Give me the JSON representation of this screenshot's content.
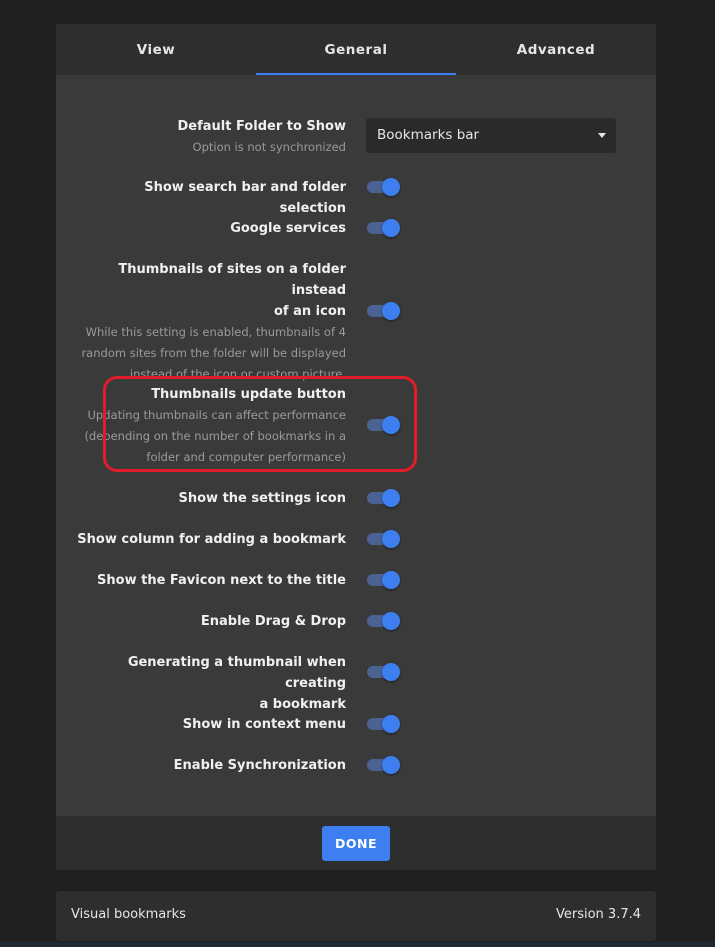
{
  "tabs": [
    {
      "label": "View"
    },
    {
      "label": "General"
    },
    {
      "label": "Advanced"
    }
  ],
  "active_tab": "General",
  "default_folder": {
    "label": "Default Folder to Show",
    "description": "Option is not synchronized",
    "selected_value": "Bookmarks bar"
  },
  "settings": [
    {
      "label": "Show search bar and folder selection",
      "enabled": true
    },
    {
      "label": "Google services",
      "enabled": true
    },
    {
      "label_line1": "Thumbnails of sites on a folder instead",
      "label_line2": "of an icon",
      "desc_line1": "While this setting is enabled, thumbnails of 4",
      "desc_line2": "random sites from the folder will be displayed",
      "desc_line3": "instead of the icon or custom picture.",
      "enabled": true
    },
    {
      "label": "Thumbnails update button",
      "desc_line1": "Updating thumbnails can affect performance",
      "desc_line2": "(depending on the number of bookmarks in a",
      "desc_line3": "folder and computer performance)",
      "enabled": true
    },
    {
      "label": "Show the settings icon",
      "enabled": true
    },
    {
      "label": "Show column for adding a bookmark",
      "enabled": true
    },
    {
      "label": "Show the Favicon next to the title",
      "enabled": true
    },
    {
      "label": "Enable Drag & Drop",
      "enabled": true
    },
    {
      "label_line1": "Generating a thumbnail when creating",
      "label_line2": "a bookmark",
      "enabled": true
    },
    {
      "label": "Show in context menu",
      "enabled": true
    },
    {
      "label": "Enable Synchronization",
      "enabled": true
    }
  ],
  "footer": {
    "done_label": "DONE"
  },
  "bottom_bar": {
    "app_name": "Visual bookmarks",
    "version": "Version 3.7.4"
  },
  "colors": {
    "accent": "#3d7ff0",
    "highlight": "#e01c2b",
    "toggle_track": "#4a6394"
  },
  "icons": {
    "select_caret": "caret-down-icon"
  }
}
